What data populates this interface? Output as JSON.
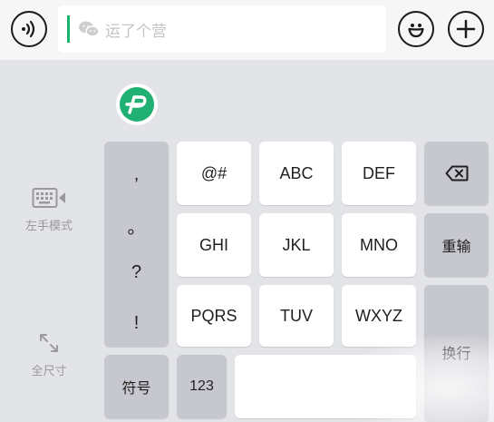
{
  "input": {
    "placeholder": "运了个营"
  },
  "side_tools": {
    "left_hand_mode": "左手模式",
    "full_size": "全尺寸"
  },
  "punctuation": [
    ",",
    "。",
    "?",
    "!"
  ],
  "keys": {
    "row1": [
      "@#",
      "ABC",
      "DEF"
    ],
    "row2": [
      "GHI",
      "JKL",
      "MNO"
    ],
    "row3": [
      "PQRS",
      "TUV",
      "WXYZ"
    ],
    "reinput": "重输",
    "enter": "换行",
    "symbols": "符号",
    "numbers": "123"
  },
  "colors": {
    "accent_green": "#20b073",
    "caret_green": "#19b36b",
    "key_white": "#ffffff",
    "key_gray": "#c7c8cf",
    "background": "#e3e4e8"
  },
  "icons": {
    "voice": "voice-icon",
    "wechat": "wechat-icon",
    "emoji": "emoji-icon",
    "plus": "plus-icon",
    "backspace": "backspace-icon",
    "keyboard": "keyboard-icon",
    "expand": "expand-icon",
    "logo": "app-logo-icon"
  }
}
